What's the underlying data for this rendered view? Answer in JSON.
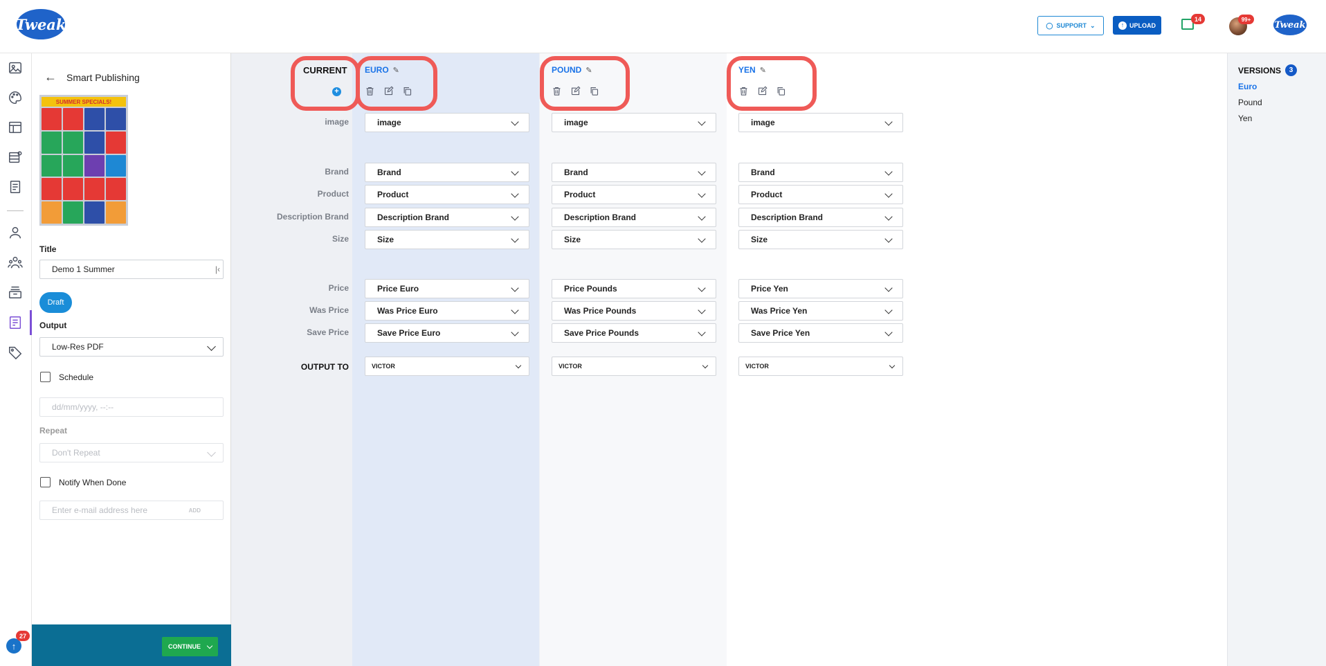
{
  "header": {
    "logo_text": "Tweak",
    "support_label": "SUPPORT",
    "upload_label": "UPLOAD",
    "notifications_count": "14",
    "messages_count": "99+",
    "brand_badge": "Tweak"
  },
  "rail": {
    "upload_count": "27",
    "icons": [
      "images-icon",
      "palette-icon",
      "layout-icon",
      "database-icon",
      "document-icon",
      "user-icon",
      "team-icon",
      "inbox-icon",
      "publishing-icon",
      "tag-icon"
    ]
  },
  "panel": {
    "title": "Smart Publishing",
    "thumbnail_text": "SUMMER SPECIALS!",
    "title_label": "Title",
    "title_value": "Demo 1 Summer",
    "status": "Draft",
    "output_label": "Output",
    "output_value": "Low-Res PDF",
    "schedule_label": "Schedule",
    "date_placeholder": "dd/mm/yyyy, --:--",
    "repeat_label": "Repeat",
    "repeat_value": "Don't Repeat",
    "notify_label": "Notify When Done",
    "email_placeholder": "Enter e-mail address here",
    "add_label": "ADD",
    "continue_label": "CONTINUE"
  },
  "mapping": {
    "current_label": "CURRENT",
    "row_labels": [
      "image",
      "Brand",
      "Product",
      "Description Brand",
      "Size",
      "Price",
      "Was Price",
      "Save Price"
    ],
    "output_to_label": "OUTPUT TO",
    "columns": [
      {
        "name": "EURO",
        "fields": [
          "image",
          "Brand",
          "Product",
          "Description Brand",
          "Size",
          "Price Euro",
          "Was Price Euro",
          "Save Price Euro"
        ],
        "output_to": "VICTOR"
      },
      {
        "name": "POUND",
        "fields": [
          "image",
          "Brand",
          "Product",
          "Description Brand",
          "Size",
          "Price Pounds",
          "Was Price Pounds",
          "Save Price Pounds"
        ],
        "output_to": "VICTOR"
      },
      {
        "name": "YEN",
        "fields": [
          "image",
          "Brand",
          "Product",
          "Description Brand",
          "Size",
          "Price Yen",
          "Was Price Yen",
          "Save Price Yen"
        ],
        "output_to": "VICTOR"
      }
    ]
  },
  "versions": {
    "title": "VERSIONS",
    "count": "3",
    "items": [
      "Euro",
      "Pound",
      "Yen"
    ]
  },
  "colors": {
    "accent": "#1a73e8",
    "highlight": "#ef5a57",
    "footer": "#0b6e94",
    "continue": "#1fa84f"
  }
}
